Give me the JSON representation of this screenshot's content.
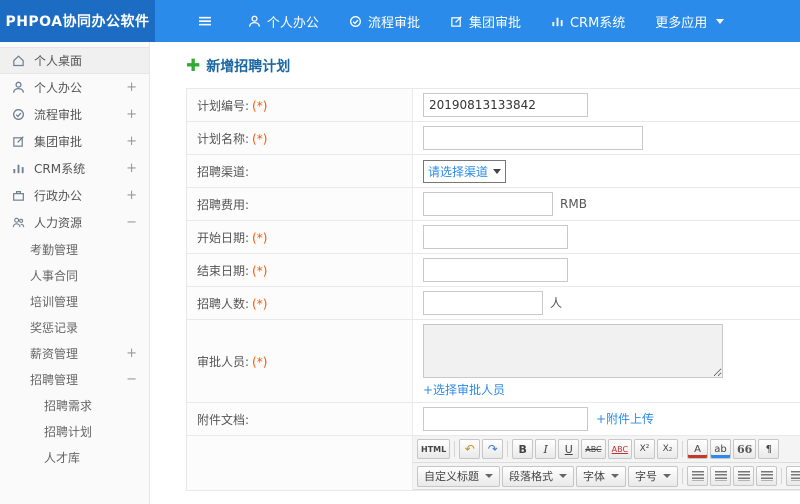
{
  "colors": {
    "topbar": "#2b8bea",
    "logo_bg": "#1b6cc2",
    "accent_link": "#2b8bea",
    "required_marker": "#ff5500",
    "title_text": "#1a66a2",
    "plus_icon_green": "#35a935"
  },
  "header": {
    "logo": "PHPOA协同办公软件",
    "menu_icon": "hamburger-icon",
    "nav": [
      {
        "label": "个人办公",
        "icon": "user-icon"
      },
      {
        "label": "流程审批",
        "icon": "flow-approval-icon"
      },
      {
        "label": "集团审批",
        "icon": "edit-approval-icon"
      },
      {
        "label": "CRM系统",
        "icon": "bar-chart-icon"
      },
      {
        "label": "更多应用",
        "icon": "caret-down-icon"
      }
    ]
  },
  "sidebar": {
    "items": [
      {
        "label": "个人桌面",
        "icon": "home-icon",
        "expand": "",
        "active": true
      },
      {
        "label": "个人办公",
        "icon": "user-icon",
        "expand": "+"
      },
      {
        "label": "流程审批",
        "icon": "flow-approval-icon",
        "expand": "+"
      },
      {
        "label": "集团审批",
        "icon": "edit-approval-icon",
        "expand": "+"
      },
      {
        "label": "CRM系统",
        "icon": "bar-chart-icon",
        "expand": "+"
      },
      {
        "label": "行政办公",
        "icon": "briefcase-icon",
        "expand": "+"
      },
      {
        "label": "人力资源",
        "icon": "people-icon",
        "expand": "−"
      }
    ],
    "hr_children": [
      {
        "label": "考勤管理",
        "expand": ""
      },
      {
        "label": "人事合同",
        "expand": ""
      },
      {
        "label": "培训管理",
        "expand": ""
      },
      {
        "label": "奖惩记录",
        "expand": ""
      },
      {
        "label": "薪资管理",
        "expand": "+"
      },
      {
        "label": "招聘管理",
        "expand": "−"
      }
    ],
    "recruit_children": [
      {
        "label": "招聘需求"
      },
      {
        "label": "招聘计划"
      },
      {
        "label": "人才库"
      }
    ]
  },
  "main": {
    "page_title": "新增招聘计划",
    "form": {
      "plan_no": {
        "label": "计划编号:",
        "required": "(*)",
        "value": "20190813133842"
      },
      "plan_name": {
        "label": "计划名称:",
        "required": "(*)",
        "value": ""
      },
      "channel": {
        "label": "招聘渠道:",
        "select_value": "请选择渠道"
      },
      "fee": {
        "label": "招聘费用:",
        "value": "",
        "suffix": "RMB"
      },
      "start_date": {
        "label": "开始日期:",
        "required": "(*)",
        "value": ""
      },
      "end_date": {
        "label": "结束日期:",
        "required": "(*)",
        "value": ""
      },
      "headcount": {
        "label": "招聘人数:",
        "required": "(*)",
        "value": "",
        "suffix": "人"
      },
      "approver": {
        "label": "审批人员:",
        "required": "(*)",
        "link": "+选择审批人员"
      },
      "attachment": {
        "label": "附件文档:",
        "value": "",
        "link": "+附件上传"
      }
    },
    "editor": {
      "row1": [
        "HTML",
        "↶",
        "↷",
        "B",
        "I",
        "U",
        "ABC",
        "ABC",
        "X²",
        "X₂",
        "A",
        "ab",
        "66",
        "¶"
      ],
      "row1_names": [
        "html-source-button",
        "undo-icon",
        "redo-icon",
        "bold-icon",
        "italic-icon",
        "underline-icon",
        "strikethrough-icon",
        "spellcheck-icon",
        "superscript-icon",
        "subscript-icon",
        "font-color-icon",
        "highlight-color-icon",
        "blockquote-icon",
        "paragraph-icon"
      ],
      "row2_dropdowns": [
        "自定义标题",
        "段落格式",
        "字体",
        "字号"
      ],
      "row2_icons": [
        "align-left-icon",
        "align-center-icon",
        "align-right-icon",
        "align-justify-icon",
        "outdent-icon",
        "indent-icon",
        "list-icon"
      ]
    }
  }
}
